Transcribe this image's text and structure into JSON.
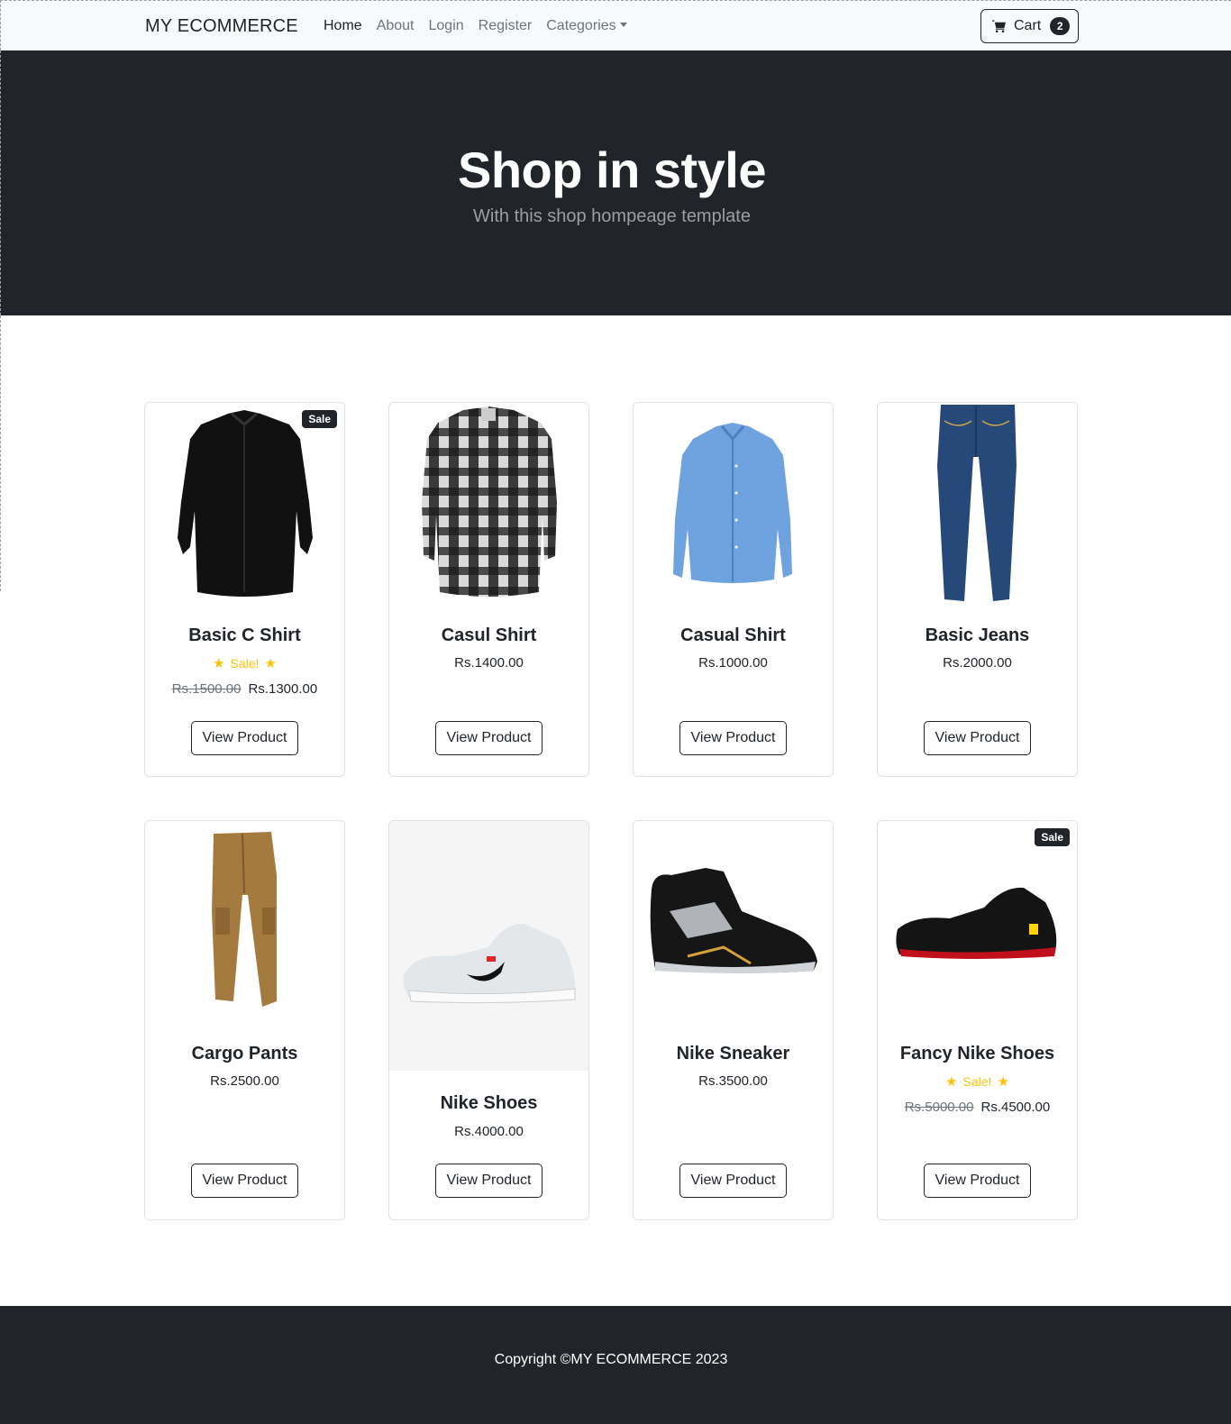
{
  "nav": {
    "brand": "MY ECOMMERCE",
    "links": [
      "Home",
      "About",
      "Login",
      "Register",
      "Categories"
    ],
    "cart_label": "Cart",
    "cart_count": "2"
  },
  "hero": {
    "title": "Shop in style",
    "subtitle": "With this shop hompeage template"
  },
  "products": [
    {
      "name": "Basic C Shirt",
      "badge": "Sale",
      "sale_text": "Sale!",
      "old_price": "Rs.1500.00",
      "price": "Rs.1300.00",
      "button": "View Product",
      "icon": "black-shirt-image"
    },
    {
      "name": "Casul Shirt",
      "price": "Rs.1400.00",
      "button": "View Product",
      "icon": "plaid-shirt-image"
    },
    {
      "name": "Casual Shirt",
      "price": "Rs.1000.00",
      "button": "View Product",
      "icon": "blue-shirt-image"
    },
    {
      "name": "Basic Jeans",
      "price": "Rs.2000.00",
      "button": "View Product",
      "icon": "jeans-image"
    },
    {
      "name": "Cargo Pants",
      "price": "Rs.2500.00",
      "button": "View Product",
      "icon": "cargo-pants-image"
    },
    {
      "name": "Nike Shoes",
      "price": "Rs.4000.00",
      "button": "View Product",
      "icon": "white-nike-shoe-image"
    },
    {
      "name": "Nike Sneaker",
      "price": "Rs.3500.00",
      "button": "View Product",
      "icon": "jordan-sneaker-image"
    },
    {
      "name": "Fancy Nike Shoes",
      "badge": "Sale",
      "sale_text": "Sale!",
      "old_price": "Rs.5000.00",
      "price": "Rs.4500.00",
      "button": "View Product",
      "icon": "black-racing-shoe-image"
    }
  ],
  "footer": {
    "copyright": "Copyright ©MY ECOMMERCE 2023"
  },
  "colors": {
    "dark": "#212529",
    "muted": "#6c757d",
    "star": "#ffc107",
    "navbar_bg": "#f8f9fa"
  }
}
